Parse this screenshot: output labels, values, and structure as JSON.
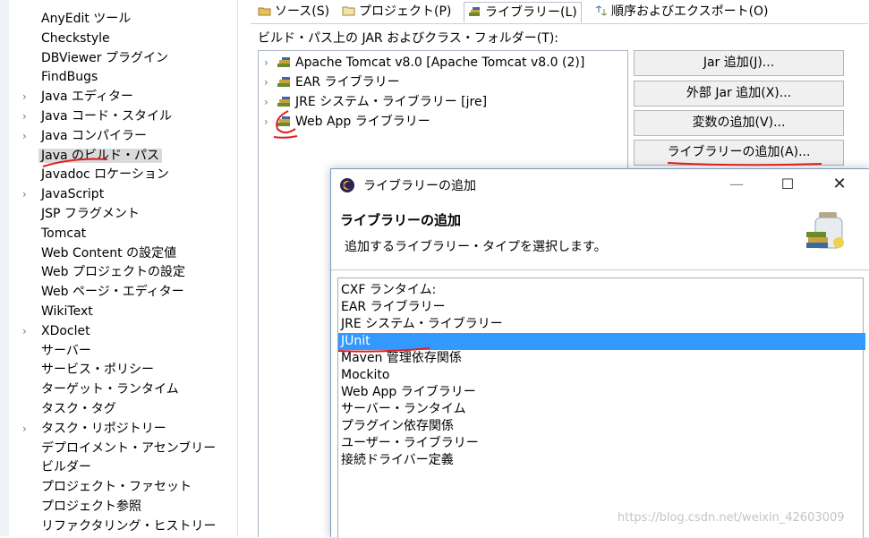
{
  "left_tree": {
    "items": [
      {
        "label": "AnyEdit ツール",
        "arrow": ""
      },
      {
        "label": "Checkstyle",
        "arrow": ""
      },
      {
        "label": "DBViewer プラグイン",
        "arrow": ""
      },
      {
        "label": "FindBugs",
        "arrow": ""
      },
      {
        "label": "Java エディター",
        "arrow": "›"
      },
      {
        "label": "Java コード・スタイル",
        "arrow": "›"
      },
      {
        "label": "Java コンパイラー",
        "arrow": "›"
      },
      {
        "label": "Java のビルド・パス",
        "arrow": ""
      },
      {
        "label": "Javadoc ロケーション",
        "arrow": ""
      },
      {
        "label": "JavaScript",
        "arrow": "›"
      },
      {
        "label": "JSP フラグメント",
        "arrow": ""
      },
      {
        "label": "Tomcat",
        "arrow": ""
      },
      {
        "label": "Web Content の設定値",
        "arrow": ""
      },
      {
        "label": "Web プロジェクトの設定",
        "arrow": ""
      },
      {
        "label": "Web ページ・エディター",
        "arrow": ""
      },
      {
        "label": "WikiText",
        "arrow": ""
      },
      {
        "label": "XDoclet",
        "arrow": "›"
      },
      {
        "label": "サーバー",
        "arrow": ""
      },
      {
        "label": "サービス・ポリシー",
        "arrow": ""
      },
      {
        "label": "ターゲット・ランタイム",
        "arrow": ""
      },
      {
        "label": "タスク・タグ",
        "arrow": ""
      },
      {
        "label": "タスク・リポジトリー",
        "arrow": "›"
      },
      {
        "label": "デプロイメント・アセンブリー",
        "arrow": ""
      },
      {
        "label": "ビルダー",
        "arrow": ""
      },
      {
        "label": "プロジェクト・ファセット",
        "arrow": ""
      },
      {
        "label": "プロジェクト参照",
        "arrow": ""
      },
      {
        "label": "リファクタリング・ヒストリー",
        "arrow": ""
      }
    ],
    "selected_index": 7
  },
  "tabs": [
    {
      "label": "ソース(S)",
      "icon": "source-folder-icon"
    },
    {
      "label": "プロジェクト(P)",
      "icon": "project-icon"
    },
    {
      "label": "ライブラリー(L)",
      "icon": "library-icon"
    },
    {
      "label": "順序およびエクスポート(O)",
      "icon": "order-export-icon"
    }
  ],
  "active_tab": 2,
  "build_path": {
    "section_label": "ビルド・パス上の JAR およびクラス・フォルダー(T):",
    "entries": [
      "Apache Tomcat v8.0 [Apache Tomcat v8.0 (2)]",
      "EAR ライブラリー",
      "JRE システム・ライブラリー [jre]",
      "Web App ライブラリー"
    ],
    "buttons": {
      "add_jar": "Jar 追加(J)...",
      "add_external_jar": "外部 Jar 追加(X)...",
      "add_variable": "変数の追加(V)...",
      "add_library": "ライブラリーの追加(A)..."
    }
  },
  "dialog": {
    "window_title": "ライブラリーの追加",
    "header_title": "ライブラリーの追加",
    "header_desc": "追加するライブラリー・タイプを選択します。",
    "library_types": [
      "CXF ランタイム:",
      "EAR ライブラリー",
      "JRE システム・ライブラリー",
      "JUnit",
      "Maven 管理依存関係",
      "Mockito",
      "Web App ライブラリー",
      "サーバー・ランタイム",
      "プラグイン依存関係",
      "ユーザー・ライブラリー",
      "接続ドライバー定義"
    ],
    "selected_type_index": 3
  },
  "watermark": "https://blog.csdn.net/weixin_42603009",
  "colors": {
    "selection": "#3399ff",
    "annotation": "#e02020",
    "tree_selection": "#dadada"
  }
}
